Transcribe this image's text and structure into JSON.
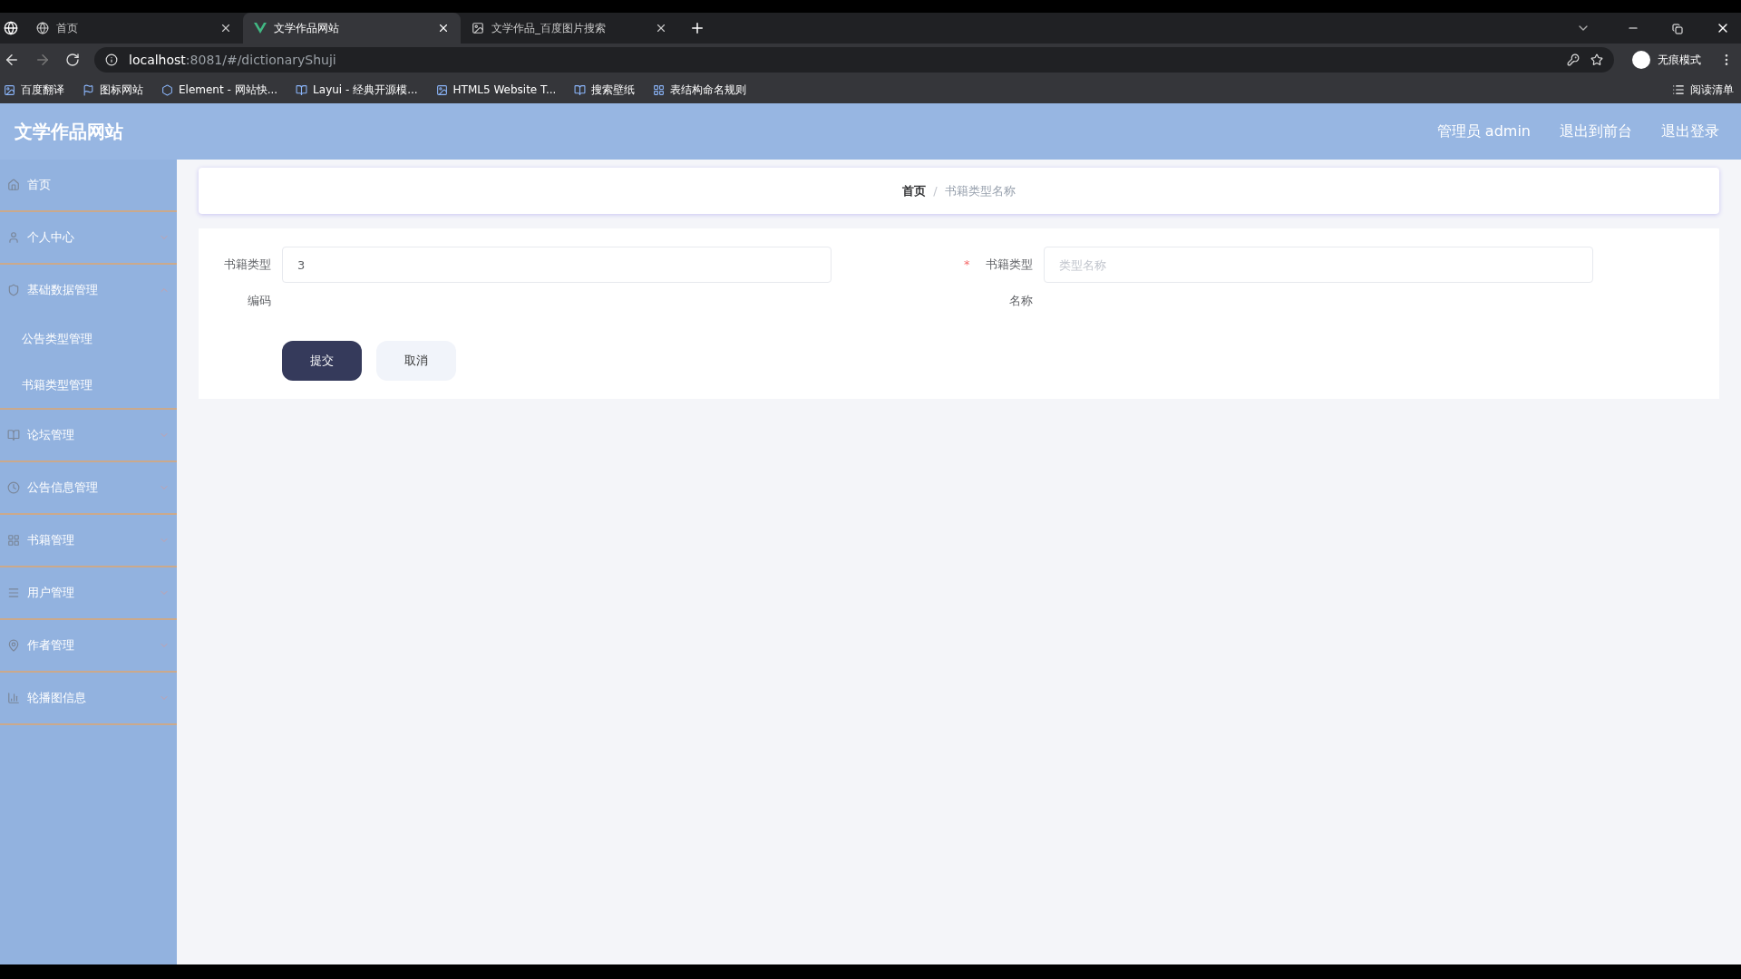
{
  "browser": {
    "tabs": [
      {
        "title": "首页",
        "selected": false
      },
      {
        "title": "文学作品网站",
        "selected": true
      },
      {
        "title": "文学作品_百度图片搜索",
        "selected": false
      }
    ],
    "url_host": "localhost",
    "url_path": ":8081/#/dictionaryShuji",
    "profile": "无痕模式",
    "bookmarks": [
      {
        "label": "百度翻译"
      },
      {
        "label": "图标网站"
      },
      {
        "label": "Element - 网站快..."
      },
      {
        "label": "Layui - 经典开源模..."
      },
      {
        "label": "HTML5 Website T..."
      },
      {
        "label": "搜索壁纸"
      },
      {
        "label": "表结构命名规则"
      }
    ],
    "reading_list": "阅读清单"
  },
  "app": {
    "title": "文学作品网站",
    "header_links": [
      "管理员 admin",
      "退出到前台",
      "退出登录"
    ]
  },
  "sidebar": {
    "items": [
      {
        "label": "首页"
      },
      {
        "label": "个人中心"
      },
      {
        "label": "基础数据管理",
        "children": [
          {
            "label": "公告类型管理"
          },
          {
            "label": "书籍类型管理"
          }
        ]
      },
      {
        "label": "论坛管理"
      },
      {
        "label": "公告信息管理"
      },
      {
        "label": "书籍管理"
      },
      {
        "label": "用户管理"
      },
      {
        "label": "作者管理"
      },
      {
        "label": "轮播图信息"
      }
    ]
  },
  "breadcrumb": {
    "items": [
      "首页",
      "书籍类型名称"
    ],
    "separator": "/"
  },
  "form": {
    "fields": [
      {
        "label": "书籍类型编码",
        "value": "3"
      },
      {
        "label": "书籍类型名称",
        "required_mark": "*",
        "placeholder": "类型名称"
      }
    ],
    "buttons": [
      {
        "label": "提交",
        "kind": "primary"
      },
      {
        "label": "取消",
        "kind": "secondary"
      }
    ]
  }
}
